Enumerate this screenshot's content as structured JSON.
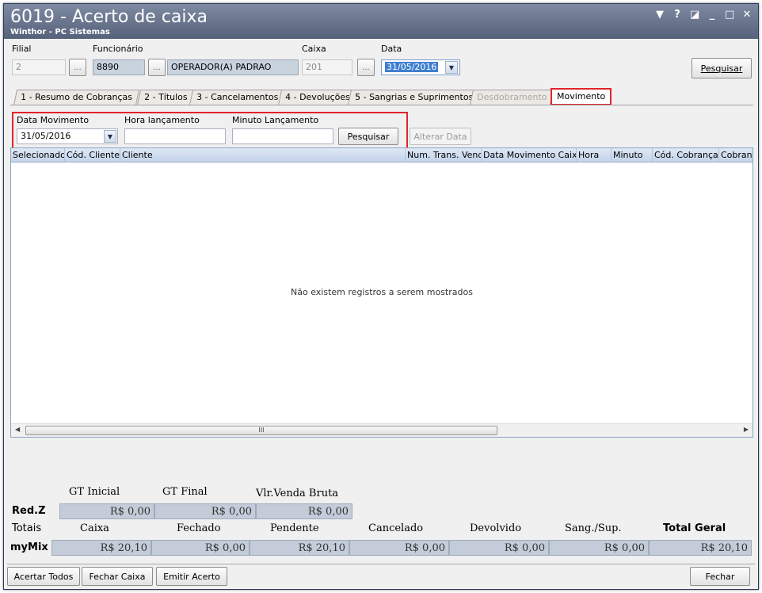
{
  "window": {
    "title": "6019 - Acerto de caixa",
    "subtitle": "Winthor - PC Sistemas",
    "controls": {
      "menu": "▼",
      "help": "?",
      "restore": "◪",
      "minimize": "_",
      "maximize": "□",
      "close": "✕"
    }
  },
  "header": {
    "filial_label": "Filial",
    "filial_value": "2",
    "funcionario_label": "Funcionário",
    "funcionario_code": "8890",
    "funcionario_name": "OPERADOR(A) PADRAO",
    "caixa_label": "Caixa",
    "caixa_value": "201",
    "data_label": "Data",
    "data_value": "31/05/2016",
    "ellipsis": "...",
    "pesquisar_label": "Pesquisar"
  },
  "tabs": [
    {
      "label": "1 - Resumo de Cobranças",
      "state": "normal"
    },
    {
      "label": "2 - Títulos",
      "state": "normal"
    },
    {
      "label": "3 - Cancelamentos",
      "state": "normal"
    },
    {
      "label": "4 - Devoluções",
      "state": "normal"
    },
    {
      "label": "5 - Sangrias e Suprimentos",
      "state": "normal"
    },
    {
      "label": "Desdobramento",
      "state": "disabled"
    },
    {
      "label": "Movimento",
      "state": "active"
    }
  ],
  "filter": {
    "data_movimento_label": "Data Movimento",
    "data_movimento_value": "31/05/2016",
    "hora_label": "Hora lançamento",
    "hora_value": "",
    "minuto_label": "Minuto Lançamento",
    "minuto_value": "",
    "pesquisar_label": "Pesquisar",
    "alterar_label": "Alterar Data"
  },
  "grid": {
    "columns": [
      "Selecionado",
      "Cód. Cliente",
      "Cliente",
      "Num. Trans. Vend",
      "Data Movimento Caixa",
      "Hora",
      "Minuto",
      "Cód. Cobrança",
      "Cobrança"
    ],
    "empty_message": "Não existem registros a serem mostrados",
    "scroll_thumb_label": "III"
  },
  "totals": {
    "headers_top": [
      "GT Inicial",
      "GT Final",
      "Vlr.Venda Bruta"
    ],
    "redz_label": "Red.Z",
    "redz_values": [
      "R$ 0,00",
      "R$ 0,00",
      "R$ 0,00"
    ],
    "totais_label": "Totais",
    "headers_bottom": [
      "Caixa",
      "Fechado",
      "Pendente",
      "Cancelado",
      "Devolvido",
      "Sang./Sup.",
      "Total Geral"
    ],
    "mymix_label": "myMix",
    "mymix_values": [
      "R$ 20,10",
      "R$ 0,00",
      "R$ 20,10",
      "R$ 0,00",
      "R$ 0,00",
      "R$ 0,00",
      "R$ 20,10"
    ]
  },
  "footer": {
    "acertar_todos": "Acertar Todos",
    "fechar_caixa": "Fechar Caixa",
    "emitir_acerto": "Emitir Acerto",
    "fechar": "Fechar"
  },
  "colors": {
    "highlight": "#e0242c",
    "titlebar": "#56617a",
    "grid_header": "#c3d3ea"
  }
}
